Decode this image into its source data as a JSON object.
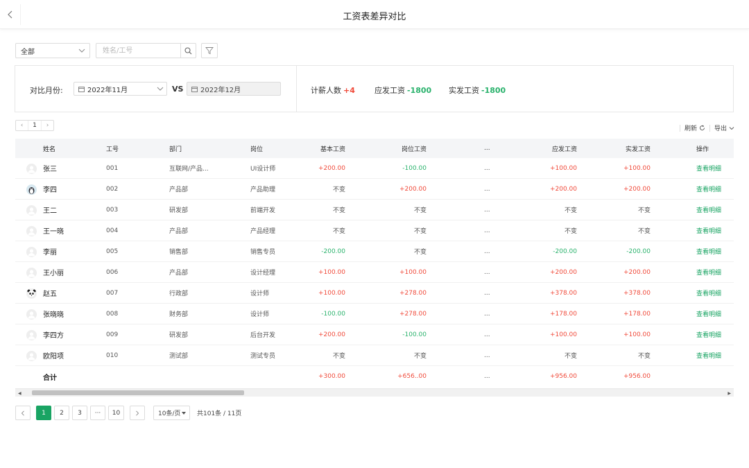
{
  "header": {
    "title": "工资表差异对比"
  },
  "filters": {
    "scope_value": "全部",
    "search_placeholder": "姓名/工号"
  },
  "compare": {
    "month_label": "对比月份:",
    "month_a": "2022年11月",
    "vs": "VS",
    "month_b": "2022年12月",
    "stats": [
      {
        "label": "计薪人数",
        "value": "+4",
        "color": "#f04a3a"
      },
      {
        "label": "应发工资",
        "value": "-1800",
        "color": "#2ab26c"
      },
      {
        "label": "实发工资",
        "value": "-1800",
        "color": "#2ab26c"
      }
    ]
  },
  "mini_pager": {
    "page": "1"
  },
  "tools": {
    "refresh": "刷新",
    "export": "导出"
  },
  "table": {
    "columns": {
      "name": "姓名",
      "id": "工号",
      "dept": "部门",
      "post": "岗位",
      "base": "基本工资",
      "position": "岗位工资",
      "more": "...",
      "due": "应发工资",
      "real": "实发工资",
      "op": "操作"
    },
    "rows": [
      {
        "name": "张三",
        "id": "001",
        "dept": "互联网/产品...",
        "post": "UI设计师",
        "base": "+200.00",
        "position": "-100.00",
        "more": "...",
        "due": "+100.00",
        "real": "+100.00",
        "op": "查看明细",
        "avatar": "blank"
      },
      {
        "name": "李四",
        "id": "002",
        "dept": "产品部",
        "post": "产品助理",
        "base": "不变",
        "position": "+200.00",
        "more": "...",
        "due": "+200.00",
        "real": "+200.00",
        "op": "查看明细",
        "avatar": "penguin"
      },
      {
        "name": "王二",
        "id": "003",
        "dept": "研发部",
        "post": "前端开发",
        "base": "不变",
        "position": "不变",
        "more": "...",
        "due": "不变",
        "real": "不变",
        "op": "查看明细",
        "avatar": "blank"
      },
      {
        "name": "王一晓",
        "id": "004",
        "dept": "产品部",
        "post": "产品经理",
        "base": "不变",
        "position": "不变",
        "more": "...",
        "due": "不变",
        "real": "不变",
        "op": "查看明细",
        "avatar": "blank"
      },
      {
        "name": "李丽",
        "id": "005",
        "dept": "销售部",
        "post": "销售专员",
        "base": "-200.00",
        "position": "不变",
        "more": "...",
        "due": "-200.00",
        "real": "-200.00",
        "op": "查看明细",
        "avatar": "blank"
      },
      {
        "name": "王小丽",
        "id": "006",
        "dept": "产品部",
        "post": "设计经理",
        "base": "+100.00",
        "position": "+100.00",
        "more": "...",
        "due": "+200.00",
        "real": "+200.00",
        "op": "查看明细",
        "avatar": "blank"
      },
      {
        "name": "赵五",
        "id": "007",
        "dept": "行政部",
        "post": "设计师",
        "base": "+100.00",
        "position": "+278.00",
        "more": "...",
        "due": "+378.00",
        "real": "+378.00",
        "op": "查看明细",
        "avatar": "panda"
      },
      {
        "name": "张晓晓",
        "id": "008",
        "dept": "财务部",
        "post": "设计师",
        "base": "-100.00",
        "position": "+278.00",
        "more": "...",
        "due": "+178.00",
        "real": "+178.00",
        "op": "查看明细",
        "avatar": "blank"
      },
      {
        "name": "李四方",
        "id": "009",
        "dept": "研发部",
        "post": "后台开发",
        "base": "+200.00",
        "position": "-100.00",
        "more": "...",
        "due": "+100.00",
        "real": "+100.00",
        "op": "查看明细",
        "avatar": "blank"
      },
      {
        "name": "欧阳项",
        "id": "010",
        "dept": "测试部",
        "post": "测试专员",
        "base": "不变",
        "position": "不变",
        "more": "...",
        "due": "不变",
        "real": "不变",
        "op": "查看明细",
        "avatar": "blank"
      }
    ],
    "total": {
      "name": "合计",
      "base": "+300.00",
      "position": "+656..00",
      "more": "...",
      "due": "+956.00",
      "real": "+956.00"
    }
  },
  "pagination": {
    "pages": [
      "1",
      "2",
      "3",
      "···",
      "10"
    ],
    "active": "1",
    "page_size": "10条/页",
    "summary": "共101条 / 11页"
  },
  "colors": {
    "accent": "#19a463",
    "increase": "#f04a3a",
    "decrease": "#2ab26c"
  }
}
